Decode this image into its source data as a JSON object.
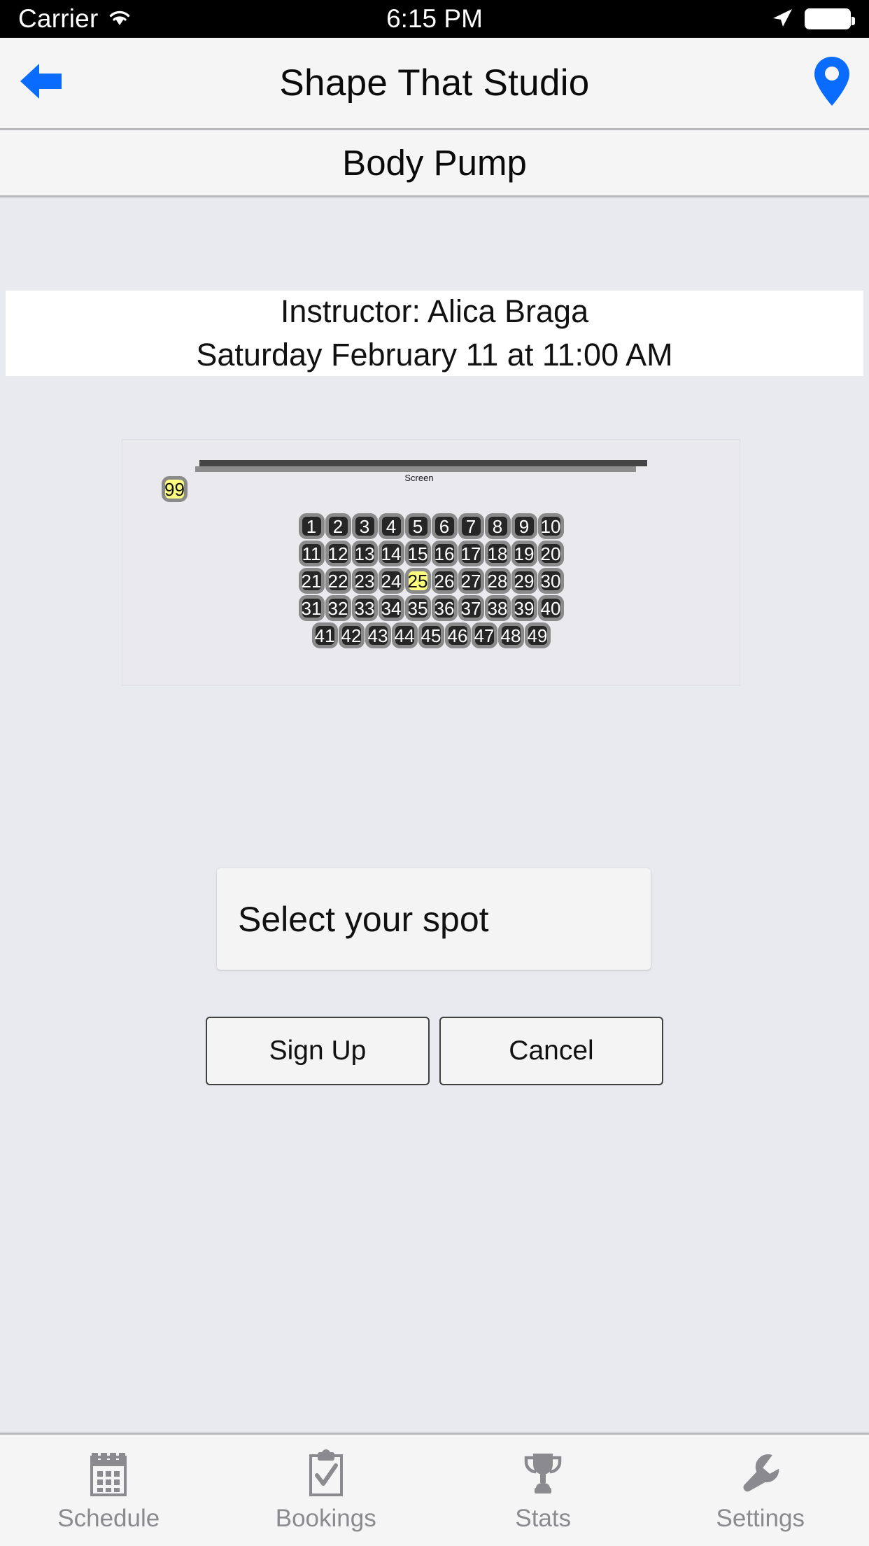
{
  "status_bar": {
    "carrier": "Carrier",
    "time": "6:15 PM",
    "wifi_icon": "wifi-icon",
    "location_icon": "location-arrow-icon",
    "battery_icon": "battery-icon"
  },
  "nav_bar": {
    "back_icon": "back-arrow-icon",
    "title": "Shape That Studio",
    "map_pin_icon": "map-pin-icon"
  },
  "class_header": {
    "class_name": "Body Pump"
  },
  "info_card": {
    "instructor_line": "Instructor: Alica Braga",
    "schedule_line": "Saturday February 11 at 11:00 AM"
  },
  "seat_map": {
    "screen_label": "Screen",
    "special_seat": {
      "label": "99",
      "state": "selected"
    },
    "selected_seat": "25",
    "rows": [
      [
        "1",
        "2",
        "3",
        "4",
        "5",
        "6",
        "7",
        "8",
        "9",
        "10"
      ],
      [
        "11",
        "12",
        "13",
        "14",
        "15",
        "16",
        "17",
        "18",
        "19",
        "20"
      ],
      [
        "21",
        "22",
        "23",
        "24",
        "25",
        "26",
        "27",
        "28",
        "29",
        "30"
      ],
      [
        "31",
        "32",
        "33",
        "34",
        "35",
        "36",
        "37",
        "38",
        "39",
        "40"
      ],
      [
        "41",
        "42",
        "43",
        "44",
        "45",
        "46",
        "47",
        "48",
        "49"
      ]
    ]
  },
  "spot_card": {
    "text": "Select your spot"
  },
  "actions": {
    "sign_up": "Sign Up",
    "cancel": "Cancel"
  },
  "tab_bar": {
    "tabs": [
      {
        "label": "Schedule",
        "icon": "calendar-icon"
      },
      {
        "label": "Bookings",
        "icon": "clipboard-check-icon"
      },
      {
        "label": "Stats",
        "icon": "trophy-icon"
      },
      {
        "label": "Settings",
        "icon": "wrench-icon"
      }
    ]
  },
  "colors": {
    "accent_blue": "#0a6cff",
    "seat_dark": "#262626",
    "seat_border": "#8a8a8a",
    "seat_selected": "#fdfd80",
    "page_bg": "#e9e9f0",
    "bar_bg": "#f5f5f5"
  }
}
